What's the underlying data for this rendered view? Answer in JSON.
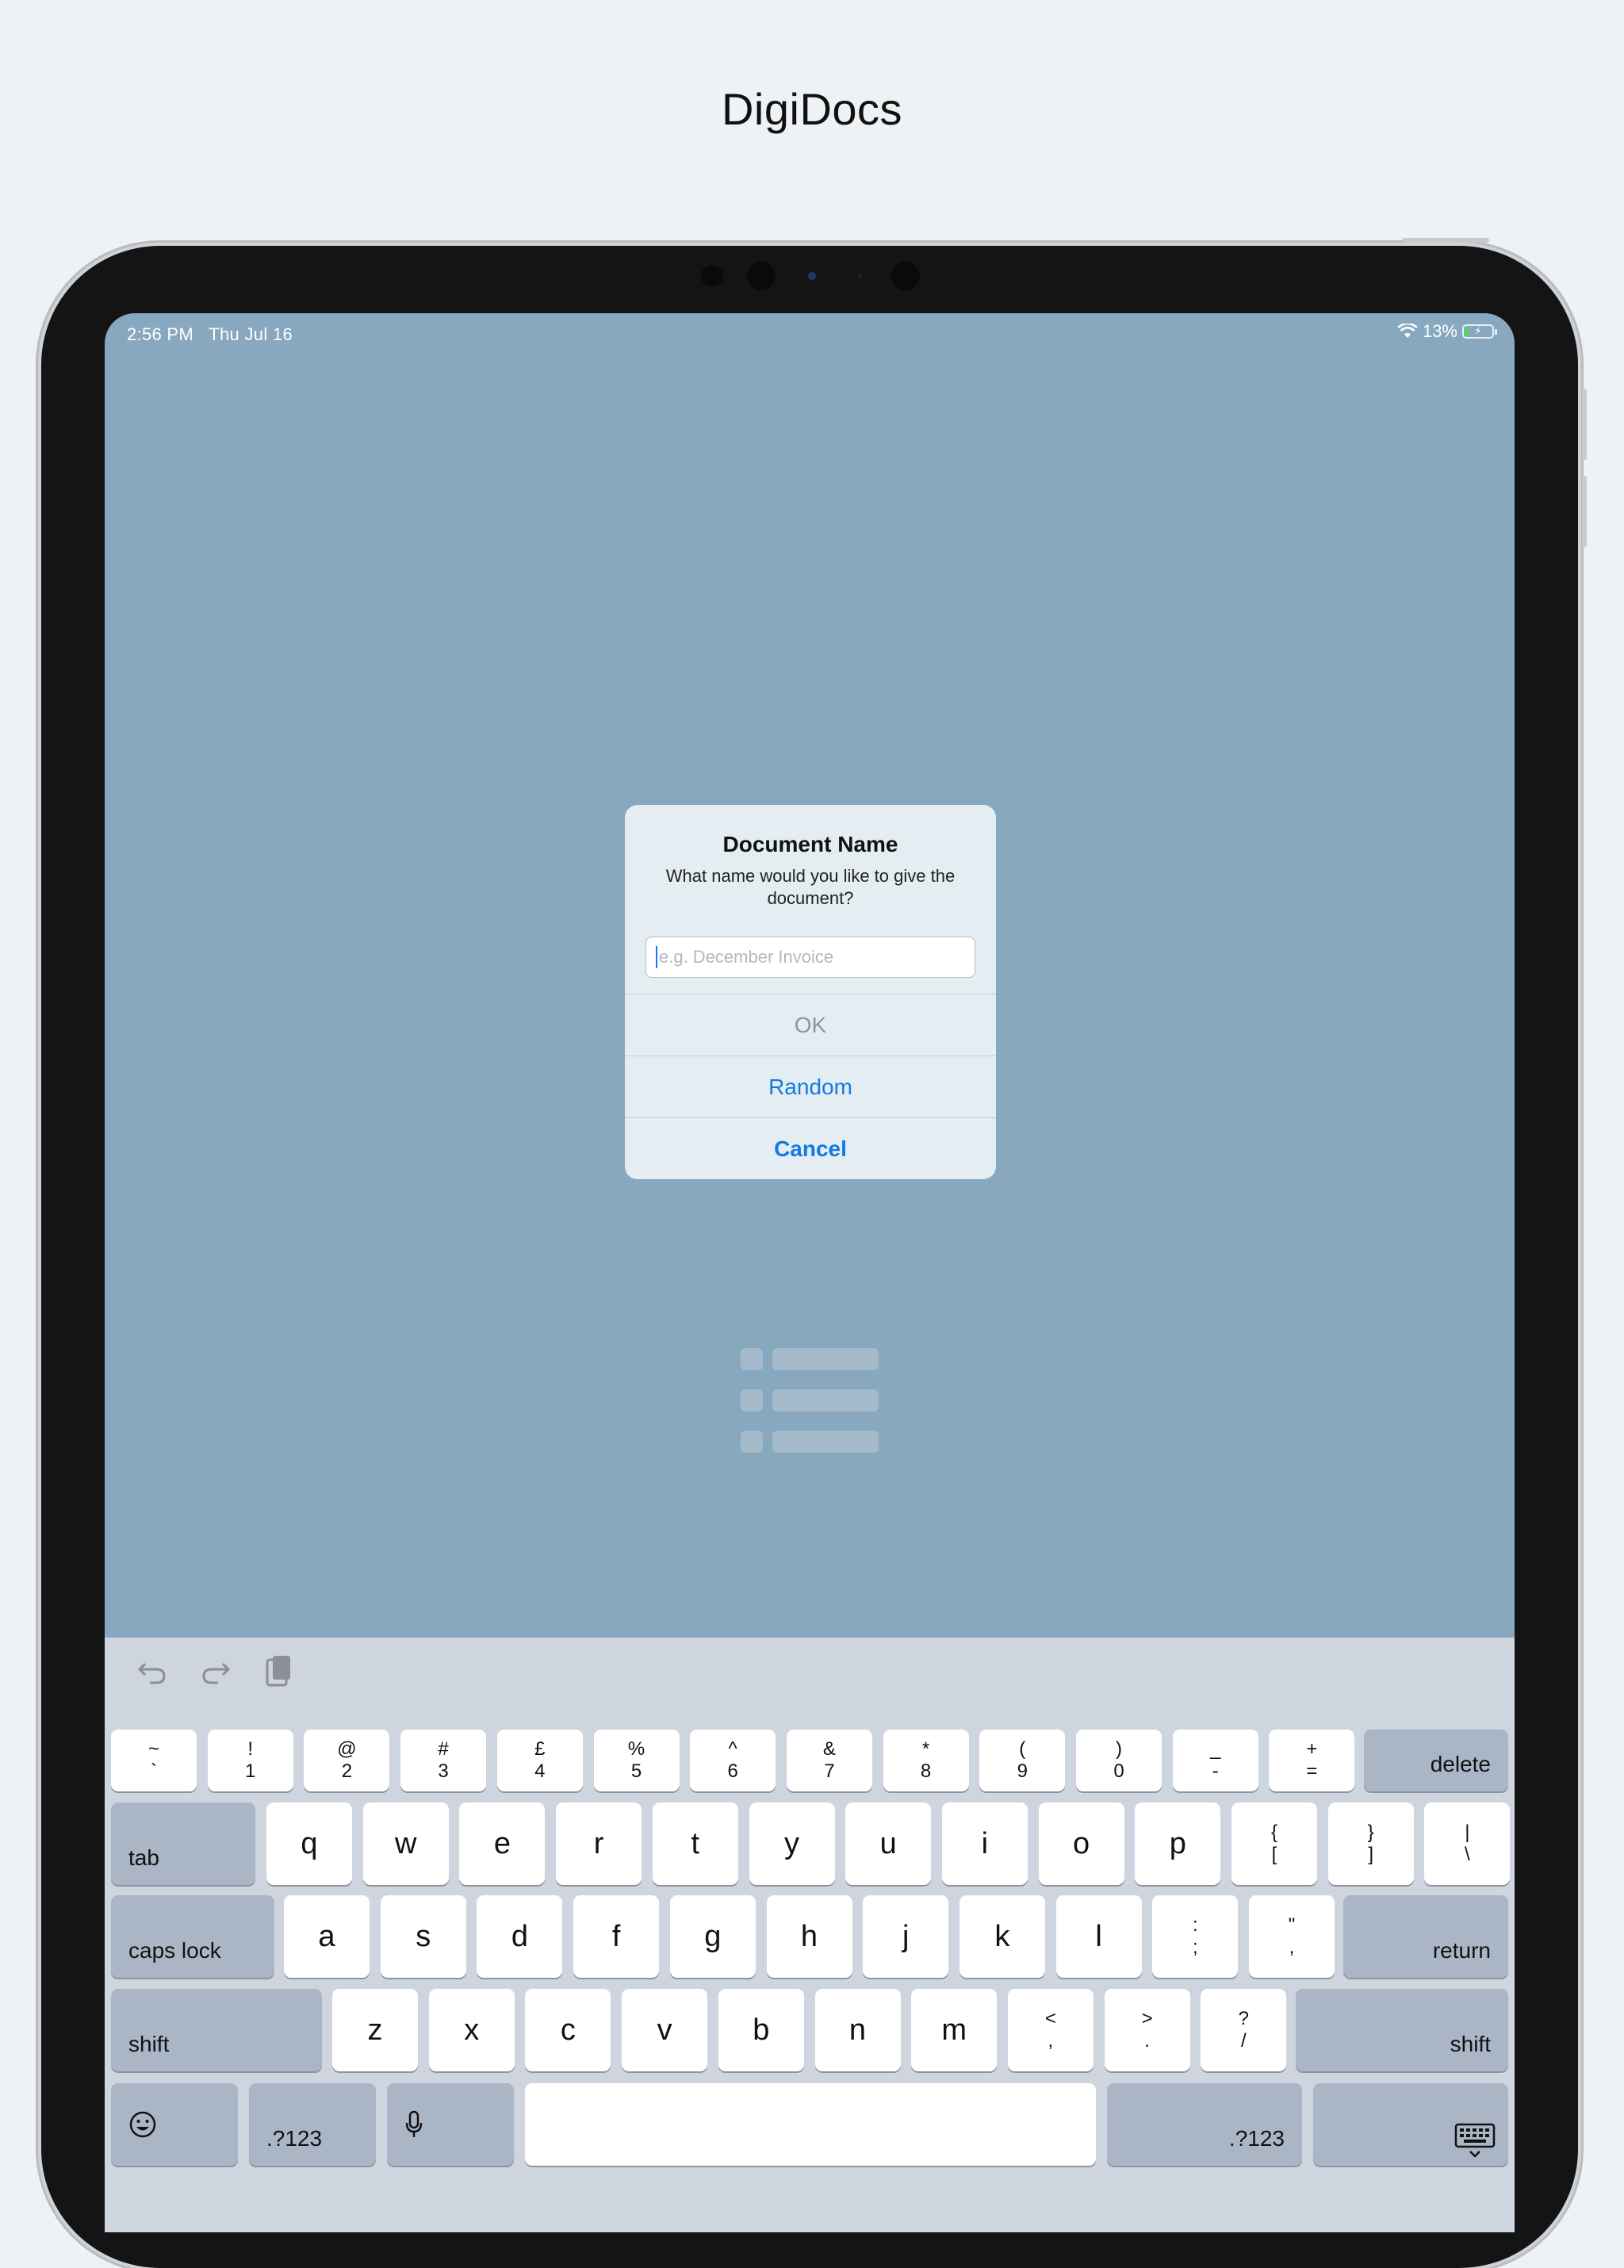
{
  "promo": {
    "title": "DigiDocs"
  },
  "status_bar": {
    "time": "2:56 PM",
    "date": "Thu Jul 16",
    "battery": "13%"
  },
  "dialog": {
    "title": "Document Name",
    "message": "What name would you like to give the document?",
    "input_placeholder": "e.g. December Invoice",
    "input_value": "",
    "buttons": {
      "ok": "OK",
      "random": "Random",
      "cancel": "Cancel"
    }
  },
  "keyboard": {
    "toolbar": [
      "undo-icon",
      "redo-icon",
      "clipboard-icon"
    ],
    "number_row": [
      {
        "top": "~",
        "bottom": "`"
      },
      {
        "top": "!",
        "bottom": "1"
      },
      {
        "top": "@",
        "bottom": "2"
      },
      {
        "top": "#",
        "bottom": "3"
      },
      {
        "top": "£",
        "bottom": "4"
      },
      {
        "top": "%",
        "bottom": "5"
      },
      {
        "top": "^",
        "bottom": "6"
      },
      {
        "top": "&",
        "bottom": "7"
      },
      {
        "top": "*",
        "bottom": "8"
      },
      {
        "top": "(",
        "bottom": "9"
      },
      {
        "top": ")",
        "bottom": "0"
      },
      {
        "top": "_",
        "bottom": "-"
      },
      {
        "top": "+",
        "bottom": "="
      }
    ],
    "delete": "delete",
    "tab": "tab",
    "row_q": [
      "q",
      "w",
      "e",
      "r",
      "t",
      "y",
      "u",
      "i",
      "o",
      "p"
    ],
    "row_q_extra": [
      {
        "top": "{",
        "bottom": "["
      },
      {
        "top": "}",
        "bottom": "]"
      },
      {
        "top": "|",
        "bottom": "\\"
      }
    ],
    "caps_lock": "caps lock",
    "row_a": [
      "a",
      "s",
      "d",
      "f",
      "g",
      "h",
      "j",
      "k",
      "l"
    ],
    "row_a_extra": [
      {
        "top": ":",
        "bottom": ";"
      },
      {
        "top": "\"",
        "bottom": ","
      }
    ],
    "return": "return",
    "shift": "shift",
    "row_z": [
      "z",
      "x",
      "c",
      "v",
      "b",
      "n",
      "m"
    ],
    "row_z_extra": [
      {
        "top": "<",
        "bottom": ","
      },
      {
        "top": ">",
        "bottom": "."
      },
      {
        "top": "?",
        "bottom": "/"
      }
    ],
    "numbers_key": ".?123"
  }
}
